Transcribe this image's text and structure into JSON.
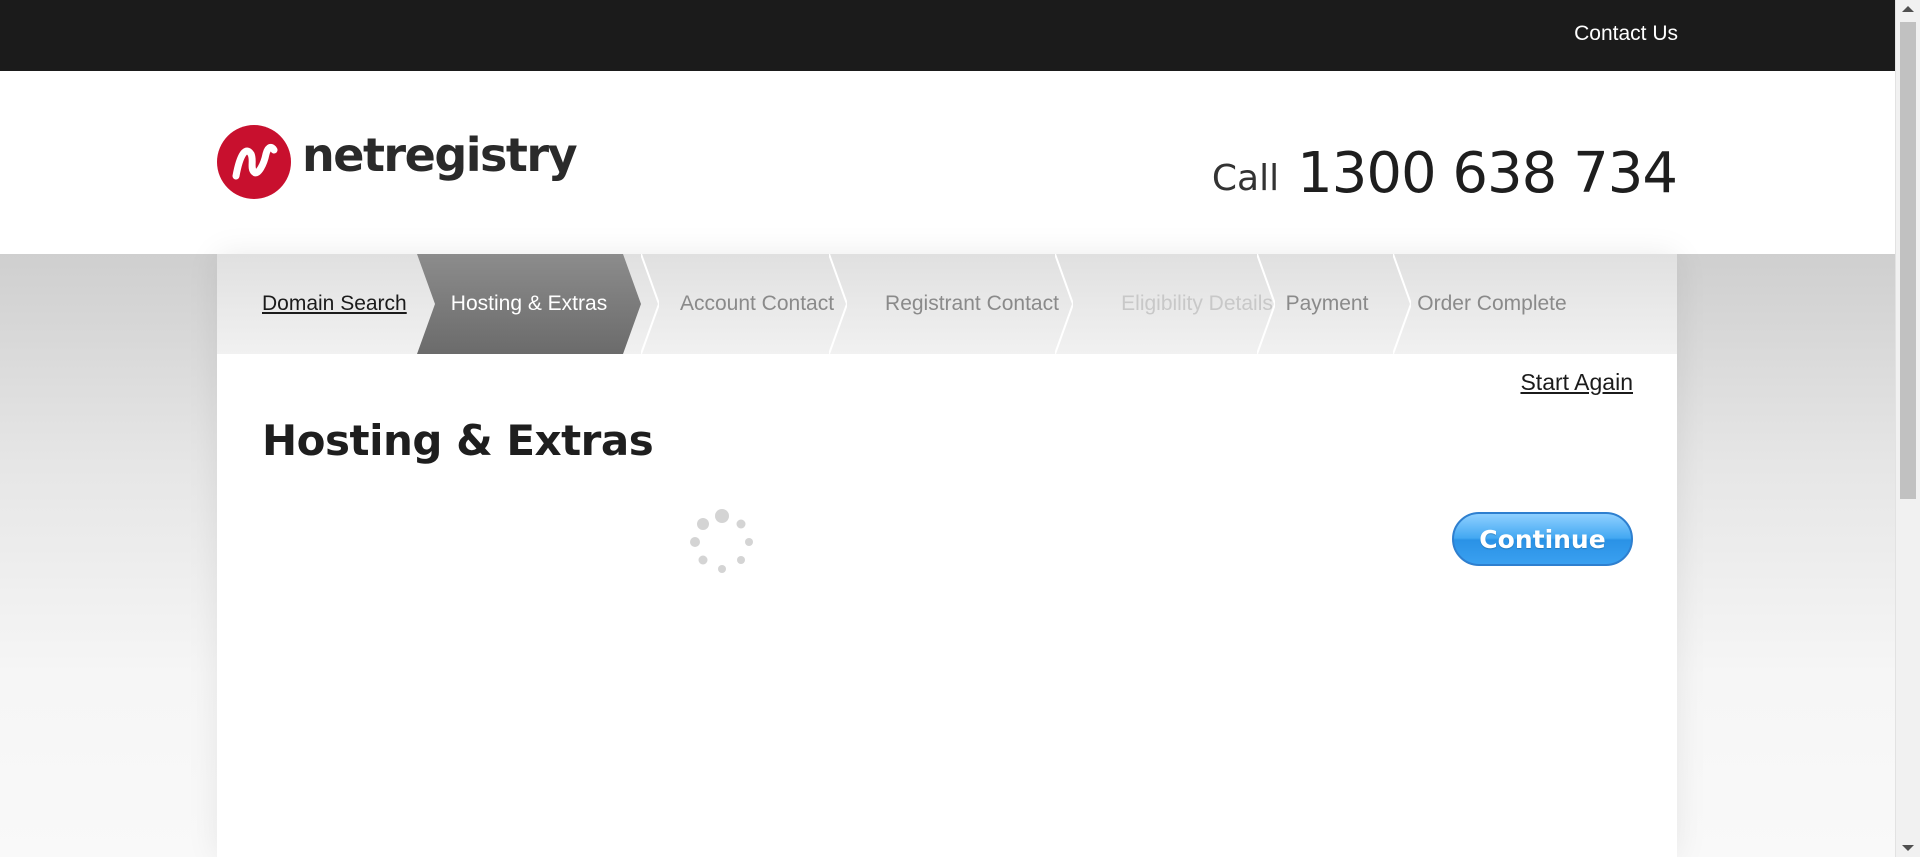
{
  "topbar": {
    "contact_label": "Contact Us"
  },
  "header": {
    "logo_text": "netregistry",
    "call_label": "Call",
    "phone_number": "1300 638 734"
  },
  "steps": [
    {
      "label": "Domain Search",
      "state": "completed"
    },
    {
      "label": "Hosting & Extras",
      "state": "active"
    },
    {
      "label": "Account Contact",
      "state": "pending"
    },
    {
      "label": "Registrant Contact",
      "state": "pending"
    },
    {
      "label": "Eligibility Details",
      "state": "disabled"
    },
    {
      "label": "Payment",
      "state": "pending"
    },
    {
      "label": "Order Complete",
      "state": "pending"
    }
  ],
  "main": {
    "start_again_label": "Start Again",
    "page_title": "Hosting & Extras",
    "continue_label": "Continue",
    "loading_icon": "spinner-icon"
  },
  "colors": {
    "topbar": "#1b1b1b",
    "brand_red": "#c8102e",
    "active_step": "#7a7a7a",
    "continue_blue": "#3aa0f0"
  }
}
